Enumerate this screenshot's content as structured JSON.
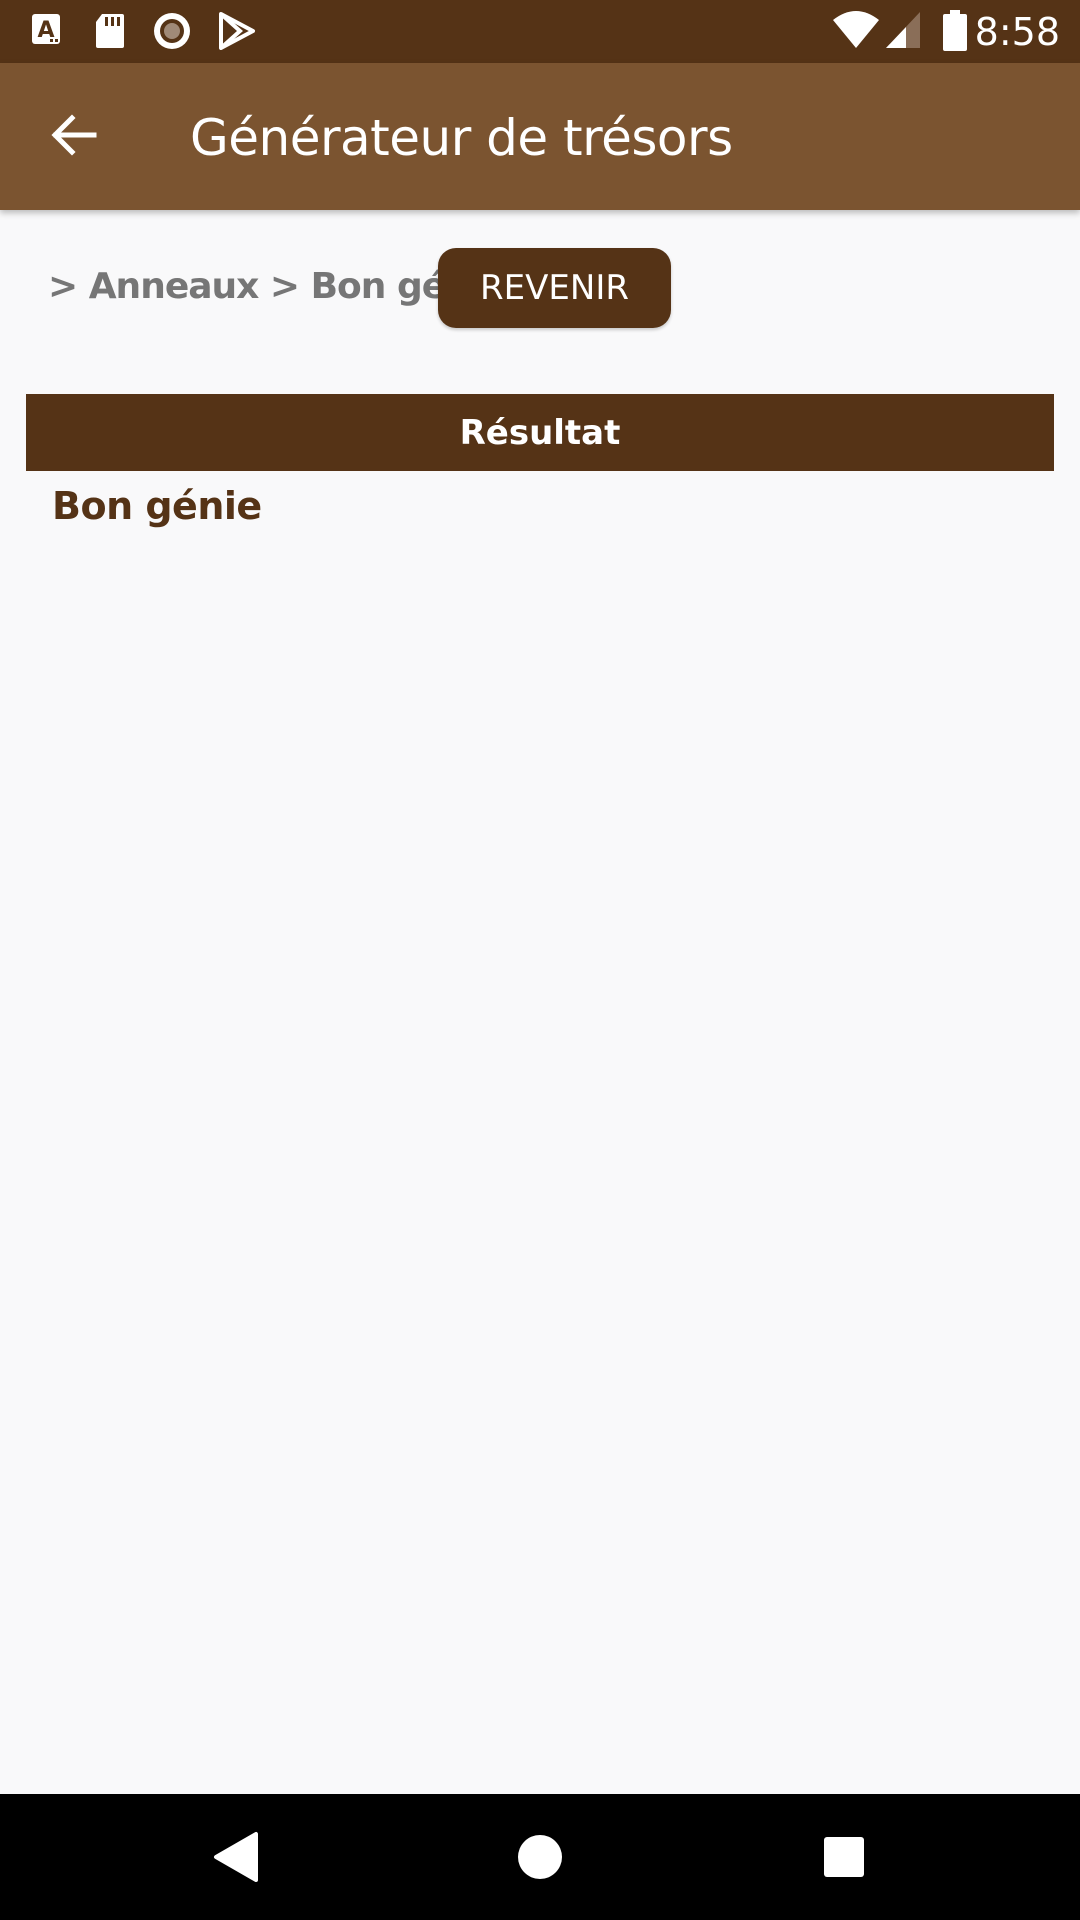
{
  "status_bar": {
    "time": "8:58",
    "icons": [
      "font-a-icon",
      "sd-card-icon",
      "record-icon",
      "play-store-icon",
      "wifi-icon",
      "signal-icon",
      "battery-icon"
    ]
  },
  "app_bar": {
    "title": "Générateur de trésors",
    "back_icon": "arrow-left-icon"
  },
  "breadcrumb": {
    "text": "> Anneaux > Bon génie"
  },
  "revenir_button": {
    "label": "REVENIR"
  },
  "result": {
    "header": "Résultat",
    "value": "Bon génie"
  },
  "nav_bar": {
    "icons": [
      "back-triangle-icon",
      "home-circle-icon",
      "recents-square-icon"
    ]
  },
  "colors": {
    "status_bar": "#553316",
    "app_bar": "#7b5430",
    "accent": "#553316",
    "breadcrumb_text": "#767676",
    "background": "#f9f9fa"
  }
}
